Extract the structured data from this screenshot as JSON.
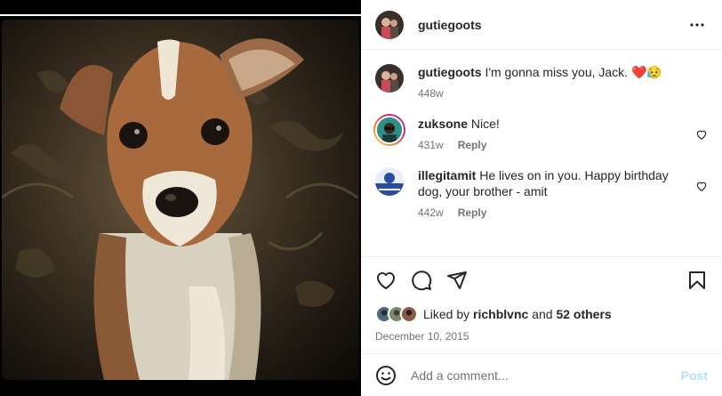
{
  "post": {
    "username": "gutiegoots",
    "more_icon": "more-horizontal-icon"
  },
  "caption": {
    "username": "gutiegoots",
    "text": "I'm gonna miss you, Jack. ",
    "emojis": "❤️😥",
    "age": "448w"
  },
  "comments": [
    {
      "username": "zuksone",
      "text": "Nice!",
      "age": "431w",
      "reply_label": "Reply"
    },
    {
      "username": "illegitamit",
      "text": "He lives on in you. Happy birthday dog, your brother - amit",
      "age": "442w",
      "reply_label": "Reply"
    }
  ],
  "likes": {
    "prefix": "Liked by ",
    "user": "richblvnc",
    "middle": " and ",
    "others": "52 others"
  },
  "date": "December 10, 2015",
  "add_comment": {
    "placeholder": "Add a comment...",
    "post_label": "Post"
  },
  "colors": {
    "post_disabled": "#b2dffc",
    "secondary_text": "#737373",
    "heart_red": "#ed4956"
  }
}
